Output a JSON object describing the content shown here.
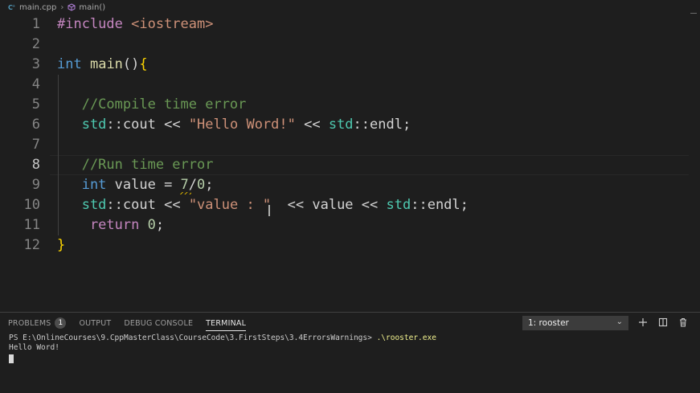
{
  "breadcrumb": {
    "file": "main.cpp",
    "symbol": "main()"
  },
  "editor": {
    "active_line": 8,
    "line_numbers": [
      "1",
      "2",
      "3",
      "4",
      "5",
      "6",
      "7",
      "8",
      "9",
      "10",
      "11",
      "12"
    ],
    "lines": [
      [
        {
          "t": "#include ",
          "c": "pre"
        },
        {
          "t": "<iostream>",
          "c": "inc"
        }
      ],
      [],
      [
        {
          "t": "int",
          "c": "kw"
        },
        {
          "t": " ",
          "c": "plain"
        },
        {
          "t": "main",
          "c": "fn"
        },
        {
          "t": "()",
          "c": "pun"
        },
        {
          "t": "{",
          "c": "br"
        }
      ],
      [],
      [
        {
          "t": "   //Compile time error",
          "c": "cm"
        }
      ],
      [
        {
          "t": "   std",
          "c": "ns"
        },
        {
          "t": "::",
          "c": "pun"
        },
        {
          "t": "cout",
          "c": "plain"
        },
        {
          "t": " << ",
          "c": "pun"
        },
        {
          "t": "\"Hello Word!\"",
          "c": "str"
        },
        {
          "t": " << ",
          "c": "pun"
        },
        {
          "t": "std",
          "c": "ns"
        },
        {
          "t": "::",
          "c": "pun"
        },
        {
          "t": "endl",
          "c": "plain"
        },
        {
          "t": ";",
          "c": "pun"
        }
      ],
      [],
      [
        {
          "t": "   //Run time error",
          "c": "cm"
        }
      ],
      [
        {
          "t": "   int",
          "c": "kw"
        },
        {
          "t": " value = ",
          "c": "plain"
        },
        {
          "t": "7",
          "c": "num"
        },
        {
          "t": "/",
          "c": "pun"
        },
        {
          "t": "0",
          "c": "num"
        },
        {
          "t": ";",
          "c": "pun"
        }
      ],
      [
        {
          "t": "   std",
          "c": "ns"
        },
        {
          "t": "::",
          "c": "pun"
        },
        {
          "t": "cout",
          "c": "plain"
        },
        {
          "t": " << ",
          "c": "pun"
        },
        {
          "t": "\"value : \"",
          "c": "str"
        },
        {
          "t": "  << ",
          "c": "pun"
        },
        {
          "t": "value",
          "c": "plain"
        },
        {
          "t": " << ",
          "c": "pun"
        },
        {
          "t": "std",
          "c": "ns"
        },
        {
          "t": "::",
          "c": "pun"
        },
        {
          "t": "endl",
          "c": "plain"
        },
        {
          "t": ";",
          "c": "pun"
        }
      ],
      [
        {
          "t": "    return",
          "c": "ctl"
        },
        {
          "t": " ",
          "c": "plain"
        },
        {
          "t": "0",
          "c": "num"
        },
        {
          "t": ";",
          "c": "pun"
        }
      ],
      [
        {
          "t": "}",
          "c": "br"
        }
      ]
    ]
  },
  "panel": {
    "tabs": [
      {
        "label": "PROBLEMS",
        "badge": "1",
        "active": false
      },
      {
        "label": "OUTPUT",
        "active": false
      },
      {
        "label": "DEBUG CONSOLE",
        "active": false
      },
      {
        "label": "TERMINAL",
        "active": true
      }
    ],
    "terminal_selector": "1: rooster",
    "actions": [
      "add-terminal-icon",
      "split-terminal-icon",
      "trash-icon"
    ]
  },
  "terminal": {
    "prompt": "PS E:\\OnlineCourses\\9.CppMasterClass\\CourseCode\\3.FirstSteps\\3.4ErrorsWarnings> ",
    "command": ".\\rooster.exe",
    "output": "Hello Word!"
  },
  "colors": {
    "background": "#1e1e1e",
    "keyword": "#569cd6",
    "string": "#ce9178",
    "comment": "#6a9955",
    "namespace": "#4ec9b0",
    "number": "#b5cea8",
    "control": "#c586c0",
    "function": "#dcdcaa",
    "bracket": "#ffd700",
    "command": "#f1f18e"
  }
}
